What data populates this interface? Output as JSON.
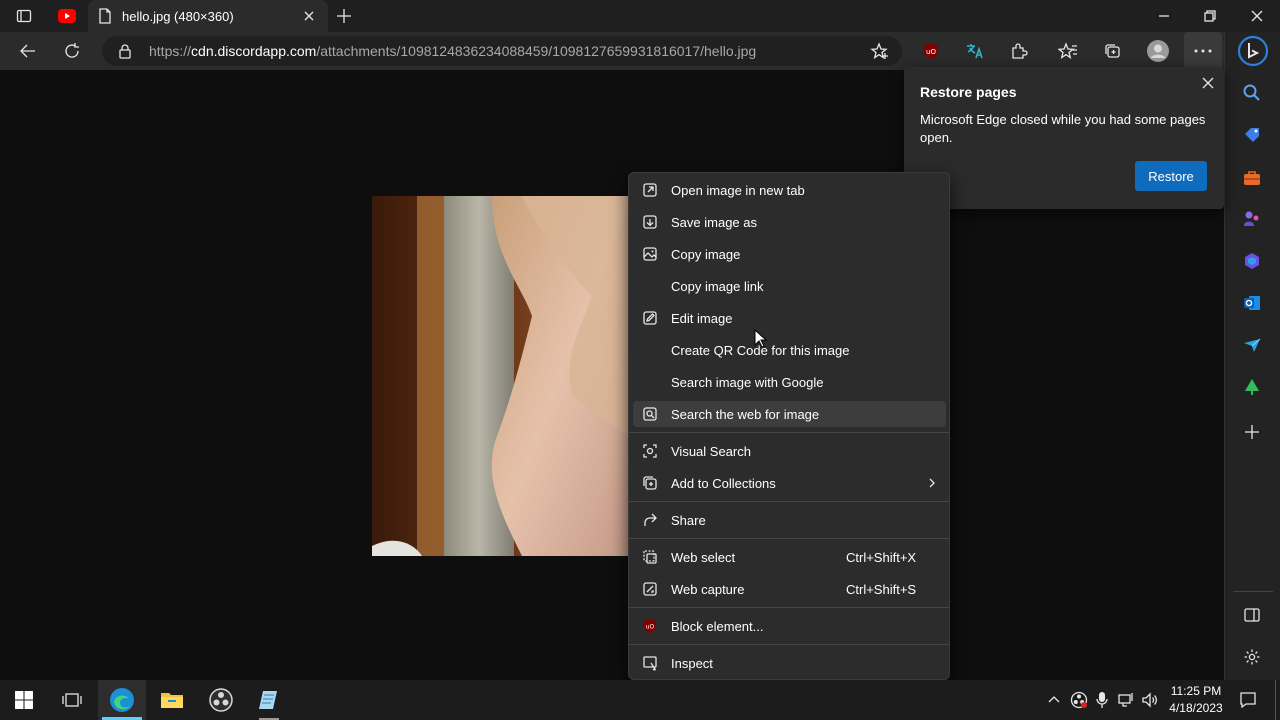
{
  "browser": {
    "tab": {
      "title": "hello.jpg (480×360)"
    },
    "address": {
      "scheme": "https://",
      "domain": "cdn.discordapp.com",
      "path": "/attachments/1098124836234088459/1098127659931816017/hello.jpg"
    }
  },
  "restore_popup": {
    "title": "Restore pages",
    "message": "Microsoft Edge closed while you had some pages open.",
    "button": "Restore"
  },
  "context_menu": {
    "items": [
      {
        "label": "Open image in new tab"
      },
      {
        "label": "Save image as"
      },
      {
        "label": "Copy image"
      },
      {
        "label": "Copy image link"
      },
      {
        "label": "Edit image"
      },
      {
        "label": "Create QR Code for this image"
      },
      {
        "label": "Search image with Google"
      },
      {
        "label": "Search the web for image"
      },
      {
        "label": "Visual Search"
      },
      {
        "label": "Add to Collections"
      },
      {
        "label": "Share"
      },
      {
        "label": "Web select",
        "shortcut": "Ctrl+Shift+X"
      },
      {
        "label": "Web capture",
        "shortcut": "Ctrl+Shift+S"
      },
      {
        "label": "Block element..."
      },
      {
        "label": "Inspect"
      }
    ]
  },
  "taskbar": {
    "time": "11:25 PM",
    "date": "4/18/2023"
  },
  "colors": {
    "accent": "#0f6cbd",
    "menu_bg": "#2c2c2c",
    "menu_hover": "#3d3d3d",
    "page_bg": "#0e0e0e"
  }
}
